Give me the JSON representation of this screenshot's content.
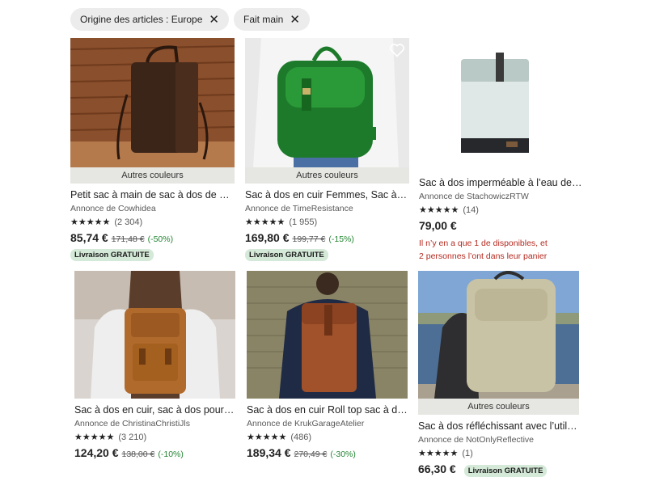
{
  "filters": [
    {
      "label": "Origine des articles : Europe",
      "remove_icon": "close-icon"
    },
    {
      "label": "Fait main",
      "remove_icon": "close-icon"
    }
  ],
  "listings": [
    {
      "colors_label": "Autres couleurs",
      "title": "Petit sac à main de sac à dos de mo…",
      "seller": "Annonce de Cowhidea",
      "stars": "★★★★★",
      "reviews": "(2 304)",
      "price": "85,74 €",
      "old_price": "171,48 €",
      "discount": "(-50%)",
      "free_shipping": "Livraison GRATUITE"
    },
    {
      "colors_label": "Autres couleurs",
      "title": "Sac à dos en cuir Femmes, Sac à do…",
      "seller": "Annonce de TimeResistance",
      "stars": "★★★★★",
      "reviews": "(1 955)",
      "price": "169,80 €",
      "old_price": "199,77 €",
      "discount": "(-15%)",
      "free_shipping": "Livraison GRATUITE",
      "favorite_icon": "heart-icon"
    },
    {
      "title": "Sac à dos imperméable à l’eau de m…",
      "seller": "Annonce de StachowiczRTW",
      "stars": "★★★★★",
      "reviews": "(14)",
      "price": "79,00 €",
      "stock_line1": "Il n’y en a que 1 de disponibles, et",
      "stock_line2": "2 personnes l’ont dans leur panier"
    },
    {
      "title": "Sac à dos en cuir, sac à dos pour fe…",
      "seller": "Annonce de ChristinaChristiJls",
      "stars": "★★★★★",
      "reviews": "(3 210)",
      "price": "124,20 €",
      "old_price": "138,00 €",
      "discount": "(-10%)"
    },
    {
      "title": "Sac à dos en cuir Roll top sac à dos …",
      "seller": "Annonce de KrukGarageAtelier",
      "stars": "★★★★★",
      "reviews": "(486)",
      "price": "189,34 €",
      "old_price": "270,49 €",
      "discount": "(-30%)"
    },
    {
      "colors_label": "Autres couleurs",
      "title": "Sac à dos réfléchissant avec l’utilisa…",
      "seller": "Annonce de NotOnlyReflective",
      "stars": "★★★★★",
      "reviews": "(1)",
      "price": "66,30 €",
      "free_shipping": "Livraison GRATUITE"
    }
  ],
  "colors": {
    "discount_green": "#258635",
    "badge_bg": "#d4e9d7",
    "stock_red": "#b5291f",
    "chip_bg": "#ececec"
  }
}
